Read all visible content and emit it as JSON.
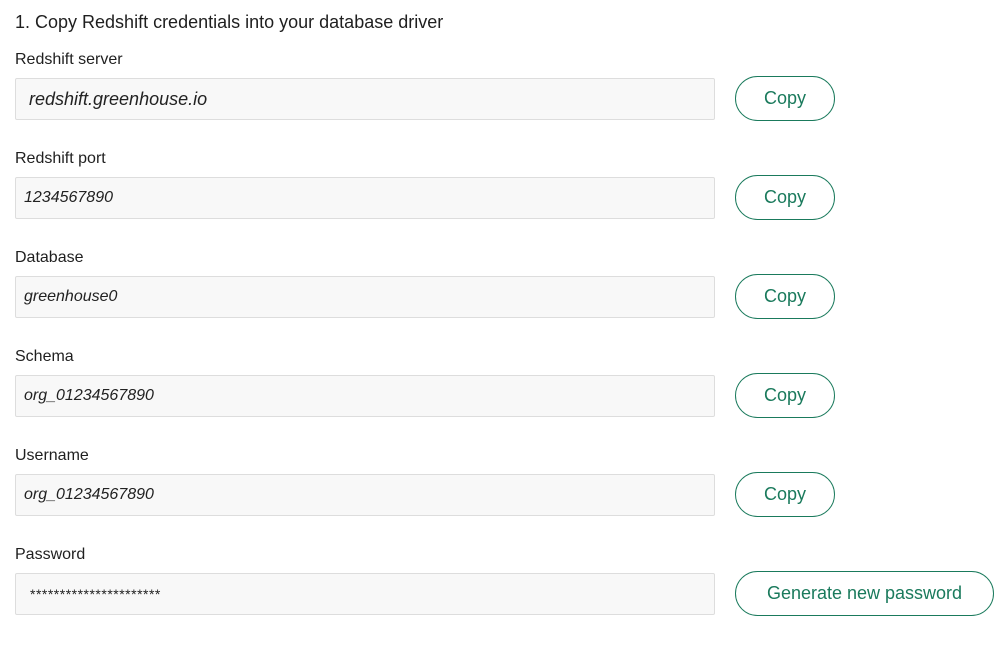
{
  "heading": "1. Copy Redshift credentials into your database driver",
  "accent_color": "#1a7a5c",
  "fields": {
    "server": {
      "label": "Redshift server",
      "value": "redshift.greenhouse.io",
      "button": "Copy"
    },
    "port": {
      "label": "Redshift port",
      "value": "1234567890",
      "button": "Copy"
    },
    "database": {
      "label": "Database",
      "value": "greenhouse0",
      "button": "Copy"
    },
    "schema": {
      "label": "Schema",
      "value": "org_01234567890",
      "button": "Copy"
    },
    "username": {
      "label": "Username",
      "value": "org_01234567890",
      "button": "Copy"
    },
    "password": {
      "label": "Password",
      "value": "**********************",
      "button": "Generate new password"
    }
  }
}
